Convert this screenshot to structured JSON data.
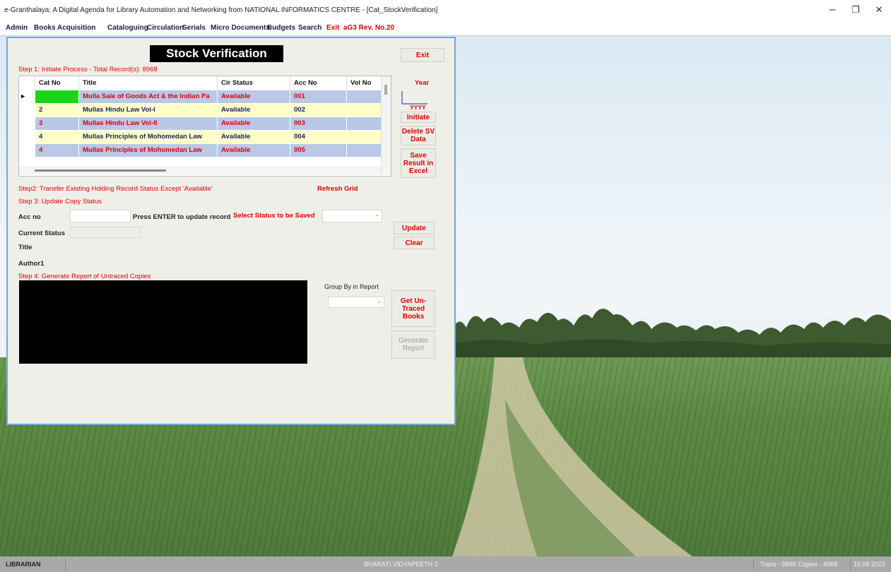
{
  "window": {
    "title": "e-Granthalaya: A Digital Agenda for Library Automation and Networking from NATIONAL INFORMATICS CENTRE - [Cat_StockVerification]",
    "minimize": "–",
    "restore": "❐",
    "close": "✕"
  },
  "menu": [
    "Admin",
    "Books Acquisition",
    "Cataloguing",
    "Circulation",
    "Serials",
    "Micro Documents",
    "Budgets",
    "Search",
    "Exit",
    "aG3 Rev. No.20"
  ],
  "form": {
    "title": "Stock Verification",
    "exit_button": "Exit",
    "step1_label": "Step 1: Initiate Process - Total Record(s): 8968",
    "year_label": "Year",
    "year_value": "",
    "year_placeholder": "YYYY",
    "initiate_button": "Initiate",
    "delete_button": "Delete SV Data",
    "save_button": "Save Result in Excel",
    "step2_label": "Step2: Transfer Existing Holding Record Status Except 'Available'",
    "refresh_grid": "Refresh Grid",
    "step3_label": "Step 3: Update Copy Status",
    "accno_label": "Acc no",
    "accno_value": "",
    "press_enter_label": "Press ENTER to update record",
    "select_status_label": "Select Status to be Saved",
    "select_status_value": "",
    "current_status_label": "Current Status",
    "current_status_value": "",
    "title_label": "Title",
    "author_label": "Author1",
    "update_button": "Update",
    "clear_button": "Clear",
    "step4_label": "Step 4: Generate Report of Untraced Copies",
    "group_by_label": "Group By in Report",
    "group_by_value": "",
    "get_untraced_button": "Get Un-Traced Books",
    "generate_report_button": "Generate Report"
  },
  "grid": {
    "columns": [
      "",
      "Cat No",
      "Title",
      "Cir Status",
      "Acc No",
      "Vol No"
    ],
    "rows": [
      {
        "indicator": "▸",
        "cat_no": "",
        "title": "Mulla Sale of Goods Act & the Indian Pa",
        "status": "Available",
        "acc_no": "001",
        "vol_no": ""
      },
      {
        "indicator": "",
        "cat_no": "2",
        "title": "Mullas Hindu Law Vol-I",
        "status": "Available",
        "acc_no": "002",
        "vol_no": ""
      },
      {
        "indicator": "",
        "cat_no": "3",
        "title": "Mullas Hindu Law Vol-II",
        "status": "Available",
        "acc_no": "003",
        "vol_no": ""
      },
      {
        "indicator": "",
        "cat_no": "4",
        "title": "Mullas Principles of Mohomedan Law",
        "status": "Available",
        "acc_no": "004",
        "vol_no": ""
      },
      {
        "indicator": "",
        "cat_no": "4",
        "title": "Mullas Principles of Mohomedan Law",
        "status": "Available",
        "acc_no": "005",
        "vol_no": ""
      }
    ]
  },
  "statusbar": {
    "left": "LIBRARIAN",
    "center": "BHARATI VIDYAPEETH 2",
    "right1": "Trans - 9898 Copies - 8968",
    "right2": "10.08.2022"
  },
  "colors": {
    "accent_red": "#e00000",
    "row_yellow": "#ffffc8",
    "row_blue": "#b9c8e6",
    "selected_cell": "#19d619",
    "form_border": "#6fa8dc"
  }
}
